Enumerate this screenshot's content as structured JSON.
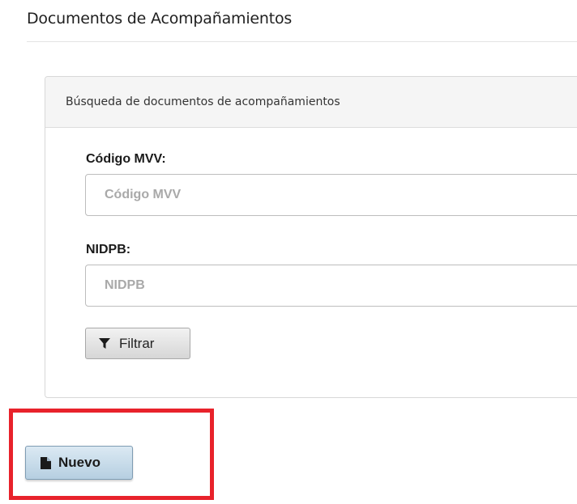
{
  "page": {
    "title": "Documentos de Acompañamientos"
  },
  "search_panel": {
    "heading": "Búsqueda de documentos de acompañamientos",
    "fields": {
      "codigo_mvv": {
        "label": "Código MVV:",
        "placeholder": "Código MVV",
        "value": ""
      },
      "nidpb": {
        "label": "NIDPB:",
        "placeholder": "NIDPB",
        "value": ""
      }
    },
    "filter_button": {
      "label": "Filtrar",
      "icon": "filter-icon"
    }
  },
  "actions": {
    "new_button": {
      "label": "Nuevo",
      "icon": "file-icon"
    }
  },
  "colors": {
    "highlight_border": "#e8222b",
    "primary_button_bg": "#c7dcec"
  }
}
